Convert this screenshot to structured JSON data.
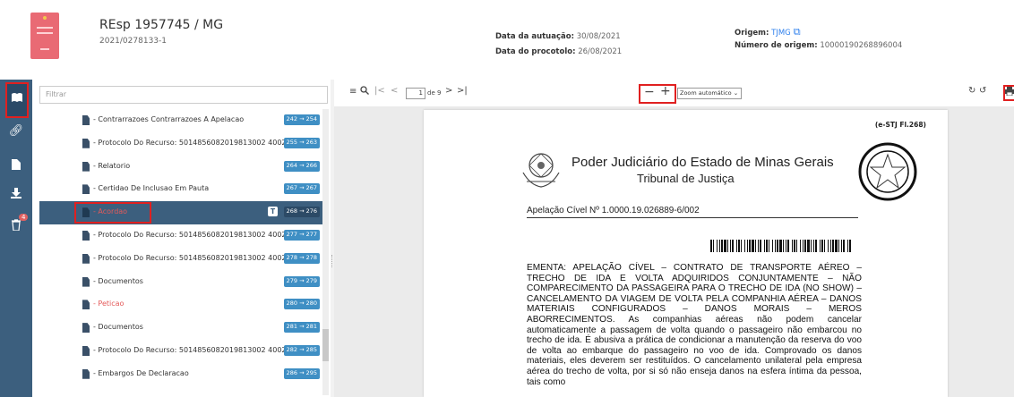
{
  "header": {
    "process_title": "REsp 1957745 / MG",
    "process_number": "2021/0278133-1",
    "autuacao_label": "Data da autuação:",
    "autuacao_value": "30/08/2021",
    "protocolo_label": "Data do procotolo:",
    "protocolo_value": "26/08/2021",
    "origem_label": "Origem:",
    "origem_value": "TJMG",
    "numero_origem_label": "Número de origem:",
    "numero_origem_value": "10000190268896004"
  },
  "rail": {
    "icons": [
      "book-icon",
      "link-icon",
      "document-icon",
      "download-icon",
      "trash-icon"
    ],
    "trash_badge": "4",
    "active_color": "#e02020"
  },
  "sidebar": {
    "filter_placeholder": "Filtrar",
    "items": [
      {
        "label": "- Contrarrazoes Contrarrazoes A Apelacao",
        "pages": "242 → 254"
      },
      {
        "label": "- Protocolo Do Recurso: 5014856082019813002 4002...",
        "pages": "255 → 263"
      },
      {
        "label": "- Relatorio",
        "pages": "264 → 266"
      },
      {
        "label": "- Certidao De Inclusao Em Pauta",
        "pages": "267 → 267"
      },
      {
        "label": "- Acordao",
        "pages": "268 → 276",
        "type_badge": "T"
      },
      {
        "label": "- Protocolo Do Recurso: 5014856082019813002 4002...",
        "pages": "277 → 277"
      },
      {
        "label": "- Protocolo Do Recurso: 5014856082019813002 4002...",
        "pages": "278 → 278"
      },
      {
        "label": "- Documentos",
        "pages": "279 → 279"
      },
      {
        "label": "- Peticao",
        "pages": "280 → 280"
      },
      {
        "label": "- Documentos",
        "pages": "281 → 281"
      },
      {
        "label": "- Protocolo Do Recurso: 5014856082019813002 4002...",
        "pages": "282 → 285"
      },
      {
        "label": "- Embargos De Declaracao",
        "pages": "286 → 295"
      }
    ]
  },
  "viewer": {
    "page_current": "1",
    "page_of": "de 9",
    "zoom": "Zoom automático",
    "stj_stamp": "(e-STJ Fl.268)",
    "court_line1": "Poder Judiciário do Estado de Minas Gerais",
    "court_line2": "Tribunal de Justiça",
    "apelacao": "Apelação Cível Nº 1.0000.19.026889-6/002",
    "ementa": "EMENTA: APELAÇÃO CÍVEL – CONTRATO DE TRANSPORTE AÉREO – TRECHO DE IDA E VOLTA ADQUIRIDOS CONJUNTAMENTE – NÃO COMPARECIMENTO DA PASSAGEIRA PARA O TRECHO DE IDA (NO SHOW) – CANCELAMENTO DA VIAGEM DE VOLTA PELA COMPANHIA AÉREA – DANOS MATERIAIS CONFIGURADOS – DANOS MORAIS – MEROS ABORRECIMENTOS. As companhias aéreas não podem cancelar automaticamente a passagem de volta quando o passageiro não embarcou no trecho de ida. É abusiva a prática de condicionar a manutenção da reserva do voo de volta ao embarque do passageiro no voo de ida. Comprovado os danos materiais, eles deverem ser restituídos. O cancelamento unilateral pela empresa aérea do trecho de volta, por si só não enseja danos na esfera íntima da pessoa, tais como"
  }
}
